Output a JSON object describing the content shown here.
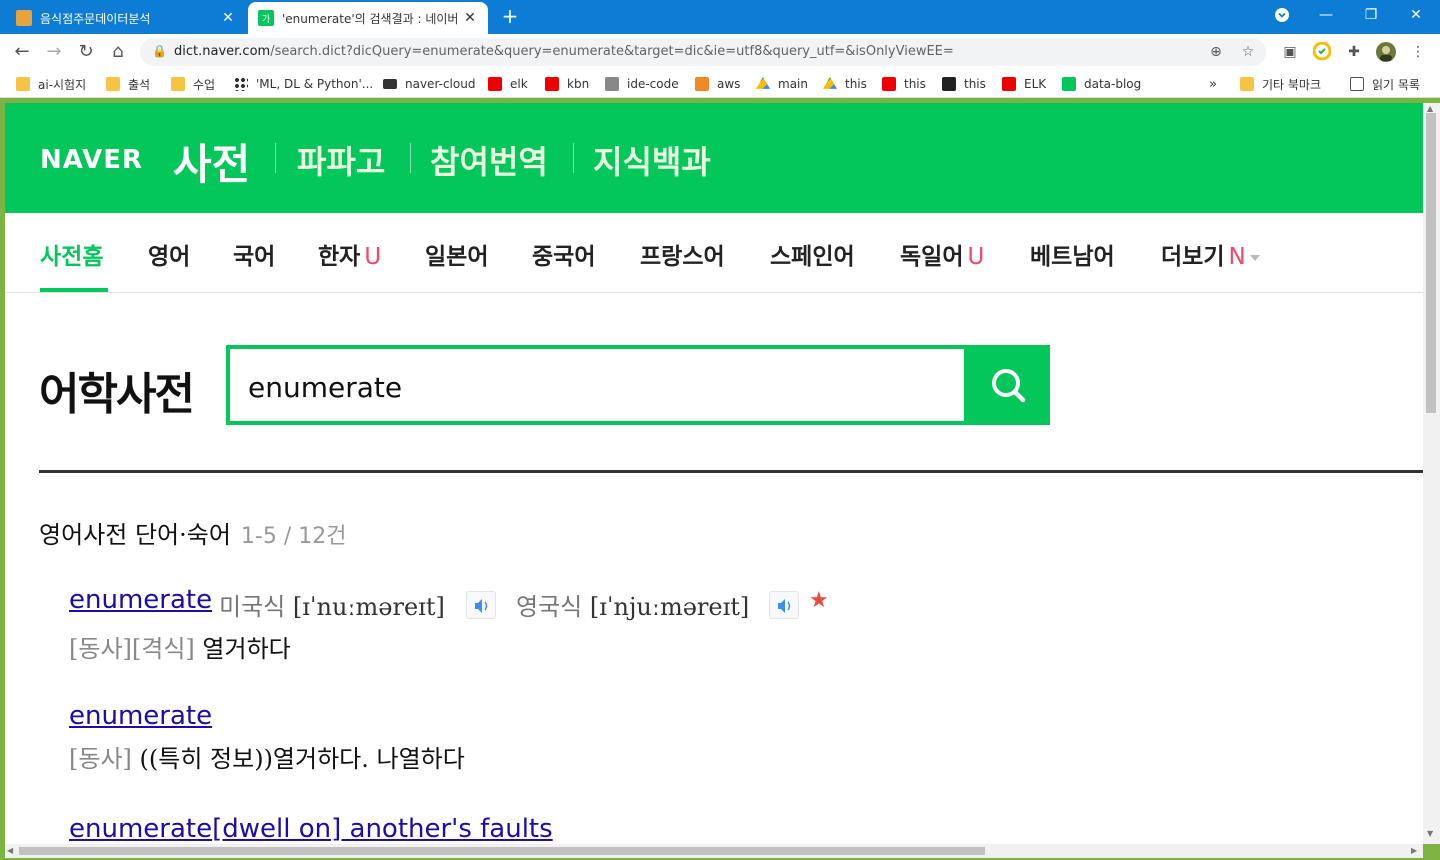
{
  "browser": {
    "tabs": [
      {
        "title": "음식점주문데이터분석",
        "active": false
      },
      {
        "title": "'enumerate'의 검색결과 : 네이버",
        "active": true
      }
    ],
    "url_host": "dict.naver.com",
    "url_rest": "/search.dict?dicQuery=enumerate&query=enumerate&target=dic&ie=utf8&query_utf=&isOnlyViewEE=",
    "bookmarks": [
      {
        "label": "ai-시험지",
        "icon": "folder-icon"
      },
      {
        "label": "출석",
        "icon": "folder-icon"
      },
      {
        "label": "수업",
        "icon": "folder-icon"
      },
      {
        "label": "'ML, DL & Python'...",
        "icon": "dots-icon"
      },
      {
        "label": "naver-cloud",
        "icon": "cloud-icon"
      },
      {
        "label": "elk",
        "icon": "youtube-icon"
      },
      {
        "label": "kbn",
        "icon": "youtube-icon"
      },
      {
        "label": "ide-code",
        "icon": "ide-icon"
      },
      {
        "label": "aws",
        "icon": "aws-icon"
      },
      {
        "label": "main",
        "icon": "drive-icon"
      },
      {
        "label": "this",
        "icon": "drive-icon"
      },
      {
        "label": "this",
        "icon": "youtube-icon"
      },
      {
        "label": "this",
        "icon": "github-icon"
      },
      {
        "label": "ELK",
        "icon": "youtube-icon"
      },
      {
        "label": "data-blog",
        "icon": "blog-icon"
      }
    ],
    "bookmarks_overflow": "»",
    "other_bookmarks": "기타 북마크",
    "reading_list": "읽기 목록"
  },
  "naver": {
    "logo": "NAVER",
    "service": "사전",
    "links": [
      "파파고",
      "참여번역",
      "지식백과"
    ],
    "nav": [
      {
        "label": "사전홈",
        "badge": ""
      },
      {
        "label": "영어",
        "badge": ""
      },
      {
        "label": "국어",
        "badge": ""
      },
      {
        "label": "한자",
        "badge": "U"
      },
      {
        "label": "일본어",
        "badge": ""
      },
      {
        "label": "중국어",
        "badge": ""
      },
      {
        "label": "프랑스어",
        "badge": ""
      },
      {
        "label": "스페인어",
        "badge": ""
      },
      {
        "label": "독일어",
        "badge": "U"
      },
      {
        "label": "베트남어",
        "badge": ""
      },
      {
        "label": "더보기",
        "badge": "N"
      }
    ],
    "dict_title": "어학사전",
    "search_value": "enumerate"
  },
  "results": {
    "section_title": "영어사전 단어·숙어",
    "count": "1-5 / 12건",
    "entries": [
      {
        "word": "enumerate",
        "us_label": "미국식",
        "us_pron": "[ɪˈnuːməreɪt]",
        "uk_label": "영국식",
        "uk_pron": "[ɪˈnjuːməreɪt]",
        "pos": "[동사][격식]",
        "meaning": "열거하다"
      },
      {
        "word": "enumerate",
        "pos": "[동사]",
        "meaning": "((특히 정보))열거하다. 나열하다"
      },
      {
        "word": "enumerate",
        "idiom": "[dwell on] another's faults"
      }
    ]
  },
  "colors": {
    "naver_green": "#03c75a",
    "chrome_blue": "#0c7cd5",
    "link_blue": "#1a0dab",
    "badge_red": "#f44766"
  }
}
